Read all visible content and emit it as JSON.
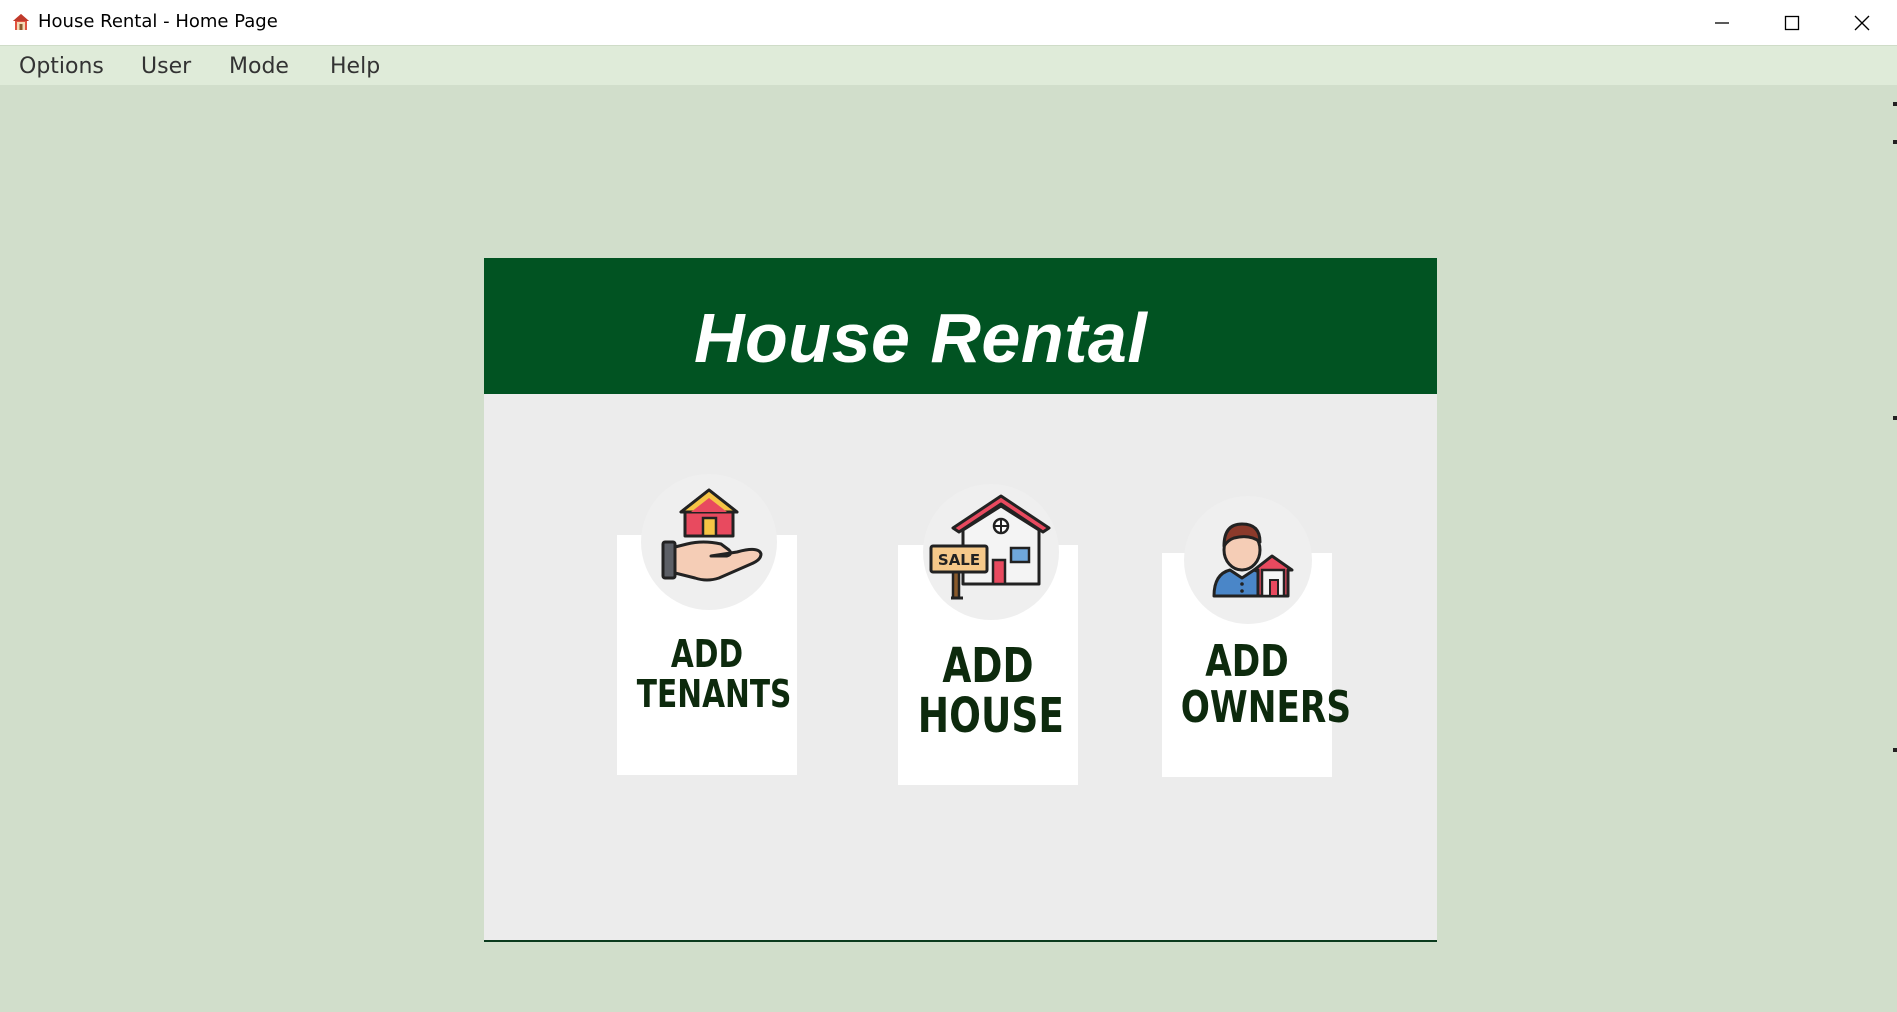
{
  "window": {
    "title": "House Rental - Home Page",
    "app_icon": "house-icon",
    "controls": {
      "minimize_icon": "minimize-icon",
      "maximize_icon": "maximize-icon",
      "close_icon": "close-icon"
    }
  },
  "menubar": {
    "items": [
      {
        "label": "Options"
      },
      {
        "label": "User"
      },
      {
        "label": "Mode"
      },
      {
        "label": "Help"
      }
    ]
  },
  "panel": {
    "title": "House Rental",
    "header_color": "#015322",
    "cards": [
      {
        "line1": "ADD",
        "line2": "TENANTS",
        "icon": "house-in-hand-icon"
      },
      {
        "line1": "ADD",
        "line2": "HOUSE",
        "icon": "house-for-sale-icon"
      },
      {
        "line1": "ADD",
        "line2": "OWNERS",
        "icon": "owner-with-house-icon"
      }
    ]
  },
  "colors": {
    "background": "#d1decb",
    "menubar": "#dfebd9",
    "panel": "#ececec",
    "label": "#0d2a0d"
  }
}
